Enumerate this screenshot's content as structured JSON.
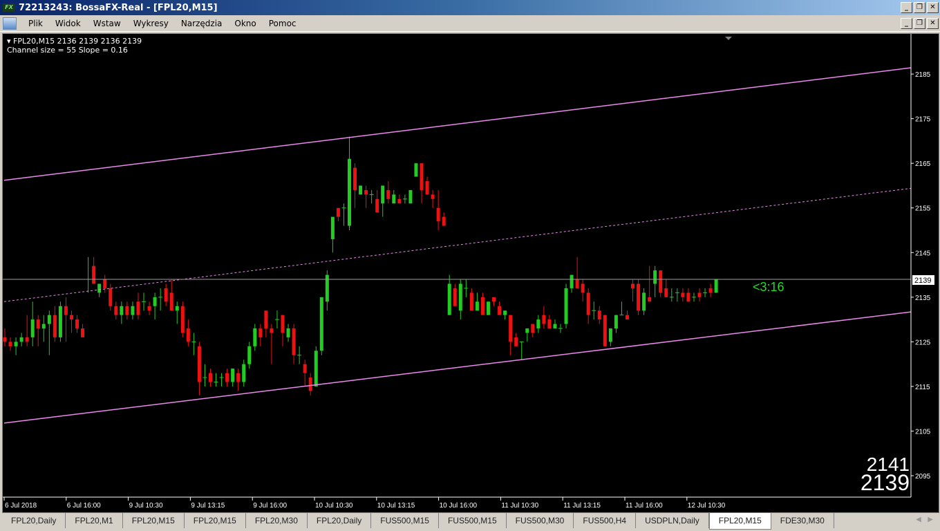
{
  "window": {
    "title": "72213243: BossaFX-Real - [FPL20,M15]",
    "logo": "FX"
  },
  "menu": {
    "items": [
      "Plik",
      "Widok",
      "Wstaw",
      "Wykresy",
      "Narzędzia",
      "Okno",
      "Pomoc"
    ]
  },
  "chart_info": {
    "line1": "FPL20,M15  2136 2139 2136 2139",
    "line2": "Channel size = 55 Slope = 0.16"
  },
  "countdown": "<3:16",
  "bid_ask": {
    "ask": "2141",
    "bid": "2139"
  },
  "current_price_label": "2139",
  "colors": {
    "bull": "#22cc22",
    "bear": "#ee1111",
    "channel": "#ee88ee",
    "background": "#000000",
    "price_line": "#a0a0a0",
    "countdown": "#22dd22"
  },
  "tabs": [
    {
      "label": "FPL20,Daily"
    },
    {
      "label": "FPL20,M1"
    },
    {
      "label": "FPL20,M15"
    },
    {
      "label": "FPL20,M15"
    },
    {
      "label": "FPL20,M30"
    },
    {
      "label": "FPL20,Daily"
    },
    {
      "label": "FUS500,M15"
    },
    {
      "label": "FUS500,M15"
    },
    {
      "label": "FUS500,M30"
    },
    {
      "label": "FUS500,H4"
    },
    {
      "label": "USDPLN,Daily"
    },
    {
      "label": "FPL20,M15",
      "active": true
    },
    {
      "label": "FDE30,M30"
    }
  ],
  "chart_data": {
    "type": "candlestick",
    "symbol": "FPL20,M15",
    "ylim": [
      2090.2,
      2194
    ],
    "y_ticks": [
      2185,
      2175,
      2165,
      2155,
      2145,
      2135,
      2125,
      2115,
      2105,
      2095
    ],
    "x_tick_labels": [
      "6 Jul 2018",
      "6 Jul 16:00",
      "9 Jul 10:30",
      "9 Jul 13:15",
      "9 Jul 16:00",
      "10 Jul 10:30",
      "10 Jul 13:15",
      "10 Jul 16:00",
      "11 Jul 10:30",
      "11 Jul 13:15",
      "11 Jul 16:00",
      "12 Jul 10:30"
    ],
    "current_price": 2139,
    "channel": {
      "upper": [
        2161.2,
        2186.4
      ],
      "middle": [
        2134,
        2159.4
      ],
      "lower": [
        2106.8,
        2131.7
      ]
    },
    "ohlc": [
      [
        2126,
        2128,
        2124,
        2125
      ],
      [
        2125,
        2126,
        2123,
        2124
      ],
      [
        2124,
        2126,
        2122,
        2125
      ],
      [
        2125,
        2127,
        2124,
        2126
      ],
      [
        2126,
        2131,
        2124,
        2125
      ],
      [
        2126,
        2134,
        2124,
        2130
      ],
      [
        2130,
        2131,
        2124,
        2128
      ],
      [
        2128,
        2131,
        2125,
        2129
      ],
      [
        2129,
        2132,
        2122,
        2131
      ],
      [
        2131,
        2133,
        2125,
        2126
      ],
      [
        2126,
        2134,
        2125,
        2133
      ],
      [
        2133,
        2135,
        2125,
        2131
      ],
      [
        2131,
        2132,
        2127,
        2130
      ],
      [
        2130,
        2131,
        2127,
        2128
      ],
      [
        2128,
        2129,
        2126,
        2126
      ],
      [
        2139,
        2144,
        2136,
        2139
      ],
      [
        2142,
        2144,
        2138,
        2138
      ],
      [
        2136,
        2138,
        2135,
        2138
      ],
      [
        2139,
        2140,
        2136,
        2137
      ],
      [
        2137,
        2138,
        2132,
        2133
      ],
      [
        2133,
        2134,
        2130,
        2131
      ],
      [
        2131,
        2134,
        2129,
        2133
      ],
      [
        2133,
        2134,
        2130,
        2131
      ],
      [
        2131,
        2134,
        2130,
        2133
      ],
      [
        2134,
        2136,
        2130,
        2131
      ],
      [
        2134,
        2136,
        2132,
        2134
      ],
      [
        2133,
        2134,
        2131,
        2132
      ],
      [
        2133,
        2136,
        2130,
        2135
      ],
      [
        2135,
        2137,
        2132,
        2135
      ],
      [
        2137,
        2138,
        2133,
        2134
      ],
      [
        2136,
        2139,
        2133,
        2132
      ],
      [
        2132,
        2134,
        2129,
        2133
      ],
      [
        2133,
        2134,
        2126,
        2127
      ],
      [
        2128,
        2130,
        2124,
        2125
      ],
      [
        2125,
        2127,
        2122,
        2125
      ],
      [
        2124,
        2125,
        2113,
        2116
      ],
      [
        2117,
        2120,
        2115,
        2117
      ],
      [
        2118,
        2119,
        2115,
        2116
      ],
      [
        2116,
        2118,
        2115,
        2116
      ],
      [
        2117,
        2118,
        2115,
        2117
      ],
      [
        2118,
        2119,
        2115,
        2116
      ],
      [
        2116,
        2119,
        2115,
        2119
      ],
      [
        2118,
        2119,
        2114,
        2116
      ],
      [
        2116,
        2121,
        2115,
        2120
      ],
      [
        2120,
        2125,
        2119,
        2124
      ],
      [
        2124,
        2129,
        2123,
        2128
      ],
      [
        2128,
        2129,
        2124,
        2126
      ],
      [
        2132,
        2132,
        2126,
        2128
      ],
      [
        2128,
        2129,
        2120,
        2127
      ],
      [
        2130,
        2132,
        2128,
        2130
      ],
      [
        2131,
        2131,
        2124,
        2127
      ],
      [
        2126,
        2129,
        2125,
        2128
      ],
      [
        2128,
        2129,
        2120,
        2122
      ],
      [
        2122,
        2124,
        2120,
        2122
      ],
      [
        2120,
        2121,
        2115,
        2118
      ],
      [
        2117,
        2118,
        2113,
        2114
      ],
      [
        2115,
        2124,
        2115,
        2123
      ],
      [
        2123,
        2135,
        2122,
        2135
      ],
      [
        2134,
        2141,
        2132,
        2140
      ],
      [
        2148,
        2153,
        2145,
        2153
      ],
      [
        2155,
        2155,
        2152,
        2153
      ],
      [
        2155,
        2156,
        2151,
        2155
      ],
      [
        2151,
        2171,
        2150,
        2166
      ],
      [
        2164,
        2165,
        2155,
        2159
      ],
      [
        2158,
        2160,
        2158,
        2160
      ],
      [
        2159,
        2160,
        2155,
        2158
      ],
      [
        2158,
        2159,
        2156,
        2158
      ],
      [
        2157,
        2159,
        2154,
        2154
      ],
      [
        2156,
        2160,
        2153,
        2160
      ],
      [
        2159,
        2161,
        2156,
        2157
      ],
      [
        2156,
        2159,
        2156,
        2158
      ],
      [
        2157,
        2158,
        2156,
        2156
      ],
      [
        2157,
        2158,
        2156,
        2157
      ],
      [
        2156,
        2159,
        2156,
        2159
      ],
      [
        2162,
        2165,
        2162,
        2165
      ],
      [
        2165,
        2165,
        2156,
        2159
      ],
      [
        2161,
        2162,
        2158,
        2158
      ],
      [
        2158,
        2159,
        2155,
        2157
      ],
      [
        2155,
        2159,
        2150,
        2152
      ],
      [
        2153,
        2154,
        2151,
        2151
      ],
      [
        2131,
        2140,
        2131,
        2138
      ],
      [
        2137,
        2138,
        2133,
        2133
      ],
      [
        2132,
        2139,
        2130,
        2138
      ],
      [
        2137,
        2139,
        2135,
        2137
      ],
      [
        2136,
        2137,
        2133,
        2132
      ],
      [
        2132,
        2136,
        2132,
        2134
      ],
      [
        2135,
        2136,
        2131,
        2131
      ],
      [
        2131,
        2134,
        2131,
        2134
      ],
      [
        2135,
        2135,
        2133,
        2134
      ],
      [
        2133,
        2134,
        2131,
        2131
      ],
      [
        2131,
        2132,
        2130,
        2132
      ],
      [
        2131,
        2131,
        2122,
        2125
      ],
      [
        2126,
        2127,
        2124,
        2124
      ],
      [
        2125,
        2125,
        2121,
        2125
      ],
      [
        2127,
        2128,
        2125,
        2128
      ],
      [
        2129,
        2129,
        2126,
        2127
      ],
      [
        2128,
        2131,
        2127,
        2130
      ],
      [
        2131,
        2133,
        2128,
        2129
      ],
      [
        2130,
        2131,
        2128,
        2128
      ],
      [
        2128,
        2130,
        2128,
        2129
      ],
      [
        2128,
        2129,
        2127,
        2128
      ],
      [
        2129,
        2138,
        2128,
        2137
      ],
      [
        2137,
        2140,
        2136,
        2140
      ],
      [
        2139,
        2144,
        2137,
        2137
      ],
      [
        2138,
        2139,
        2134,
        2136
      ],
      [
        2136,
        2137,
        2129,
        2131
      ],
      [
        2132,
        2134,
        2130,
        2132
      ],
      [
        2132,
        2133,
        2129,
        2130
      ],
      [
        2131,
        2131,
        2124,
        2124
      ],
      [
        2125,
        2128,
        2124,
        2128
      ],
      [
        2128,
        2131,
        2127,
        2131
      ],
      [
        2131,
        2134,
        2131,
        2131
      ],
      [
        2131,
        2132,
        2130,
        2130
      ],
      [
        2138,
        2139,
        2134,
        2137
      ],
      [
        2138,
        2139,
        2131,
        2132
      ],
      [
        2132,
        2137,
        2131,
        2136
      ],
      [
        2135,
        2142,
        2134,
        2134
      ],
      [
        2138,
        2142,
        2135,
        2141
      ],
      [
        2141,
        2141,
        2135,
        2136
      ],
      [
        2137,
        2139,
        2135,
        2135
      ],
      [
        2135,
        2137,
        2134,
        2135
      ],
      [
        2136,
        2137,
        2134,
        2136
      ],
      [
        2136,
        2137,
        2134,
        2135
      ],
      [
        2136,
        2137,
        2134,
        2134
      ],
      [
        2135,
        2136,
        2134,
        2135
      ],
      [
        2136,
        2137,
        2134,
        2135
      ],
      [
        2136,
        2137,
        2135,
        2136
      ],
      [
        2137,
        2138,
        2135,
        2136
      ],
      [
        2136,
        2139,
        2136,
        2139
      ]
    ]
  }
}
